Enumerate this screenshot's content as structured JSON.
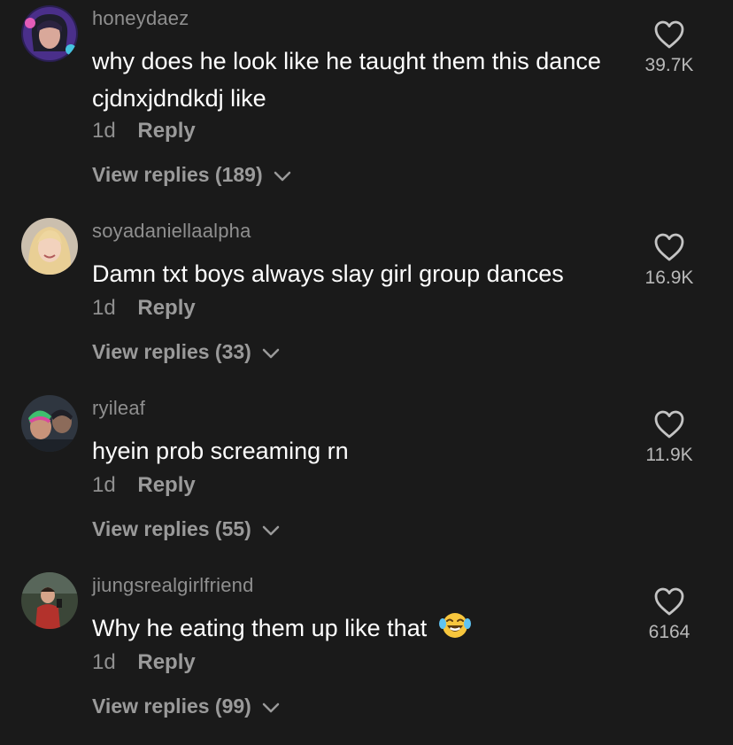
{
  "comments": [
    {
      "username": "honeydaez",
      "text": "why does he look like he taught them this dance cjdnxjdndkdj like",
      "time": "1d",
      "reply_label": "Reply",
      "view_replies": "View replies (189)",
      "likes": "39.7K",
      "avatar_colors": [
        "#3a2a6e",
        "#c94fb0"
      ]
    },
    {
      "username": "soyadaniellaalpha",
      "text": "Damn txt boys always slay girl group dances",
      "time": "1d",
      "reply_label": "Reply",
      "view_replies": "View replies (33)",
      "likes": "16.9K",
      "avatar_colors": [
        "#d8c6a8",
        "#f1d49a"
      ]
    },
    {
      "username": "ryileaf",
      "text": "hyein prob screaming rn",
      "time": "1d",
      "reply_label": "Reply",
      "view_replies": "View replies (55)",
      "likes": "11.9K",
      "avatar_colors": [
        "#2d3542",
        "#3fae7a"
      ]
    },
    {
      "username": "jiungsrealgirlfriend",
      "text": "Why he eating them up like that",
      "time": "1d",
      "reply_label": "Reply",
      "view_replies": "View replies (99)",
      "likes": "6164",
      "avatar_colors": [
        "#3f4a3a",
        "#b3322c"
      ]
    }
  ],
  "icons": {
    "like": "heart-outline-icon",
    "expand": "chevron-down-icon",
    "emoji": "face-with-tears-of-joy-emoji"
  },
  "colors": {
    "background": "#1a1a1a",
    "primary_text": "#ffffff",
    "secondary_text": "#8f8f8f"
  }
}
